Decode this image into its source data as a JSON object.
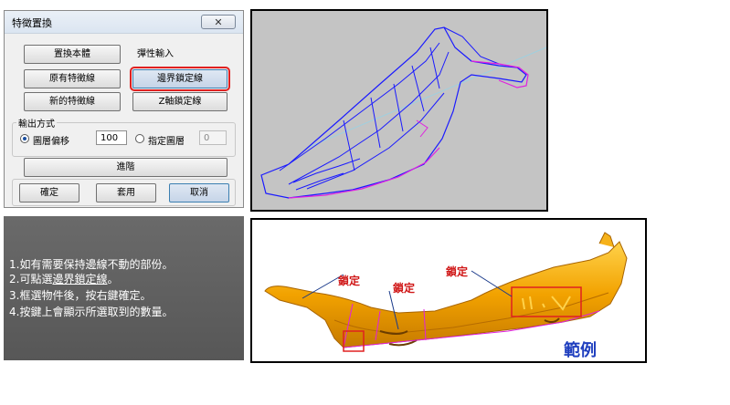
{
  "dialog": {
    "title": "特徵置換",
    "close_label": "✕",
    "buttons": {
      "replace_body": "置換本體",
      "original_feature_line": "原有特徵線",
      "new_feature_line": "新的特徵線",
      "boundary_lock_line": "邊界鎖定線",
      "z_axis_lock_line": "Z軸鎖定線",
      "advanced": "進階",
      "ok": "確定",
      "apply": "套用",
      "cancel": "取消"
    },
    "elastic_input_label": "彈性輸入",
    "output_group_label": "輸出方式",
    "layer_offset_label": "圖層偏移",
    "layer_offset_value": "100",
    "specified_layer_label": "指定圖層",
    "specified_layer_value": "0"
  },
  "note": {
    "line1": "1.如有需要保持邊線不動的部份。",
    "line2_prefix": "2.可點選",
    "line2_link": "邊界鎖定線",
    "line2_suffix": "。",
    "line3": "3.框選物件後，按右鍵確定。",
    "line4": "4.按鍵上會顯示所選取到的數量。"
  },
  "example_view": {
    "lock_label": "鎖定",
    "example_label": "範例"
  },
  "colors": {
    "highlight": "#e02020",
    "wire_blue": "#1a1aff",
    "wire_magenta": "#e020e0",
    "part_orange": "#f2a200",
    "annotation_red": "#d01818",
    "example_blue": "#1f3fbf"
  }
}
